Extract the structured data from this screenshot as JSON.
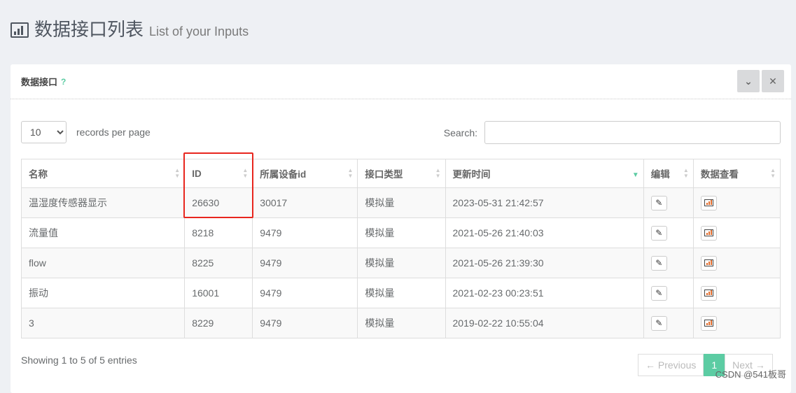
{
  "header": {
    "title": "数据接口列表",
    "subtitle": "List of your Inputs",
    "icon": "bar-chart-icon"
  },
  "panel": {
    "title": "数据接口",
    "help": "?",
    "collapse_icon": "chevron-down-icon",
    "close_icon": "close-icon"
  },
  "length": {
    "value": "10",
    "label": "records per page"
  },
  "search": {
    "label": "Search:",
    "value": ""
  },
  "table": {
    "columns": [
      "名称",
      "ID",
      "所属设备id",
      "接口类型",
      "更新时间",
      "编辑",
      "数据查看"
    ],
    "rows": [
      [
        "温湿度传感器显示",
        "26630",
        "30017",
        "模拟量",
        "2023-05-31 21:42:57"
      ],
      [
        "流量值",
        "8218",
        "9479",
        "模拟量",
        "2021-05-26 21:40:03"
      ],
      [
        "flow",
        "8225",
        "9479",
        "模拟量",
        "2021-05-26 21:39:30"
      ],
      [
        "振动",
        "16001",
        "9479",
        "模拟量",
        "2021-02-23 00:23:51"
      ],
      [
        "3",
        "8229",
        "9479",
        "模拟量",
        "2019-02-22 10:55:04"
      ]
    ]
  },
  "info": "Showing 1 to 5 of 5 entries",
  "pager": {
    "previous": "← Previous",
    "current": "1",
    "next": "Next →"
  },
  "watermark": "CSDN @541板哥",
  "colors": {
    "accent": "#5ccca3",
    "highlight": "#e8261e"
  }
}
